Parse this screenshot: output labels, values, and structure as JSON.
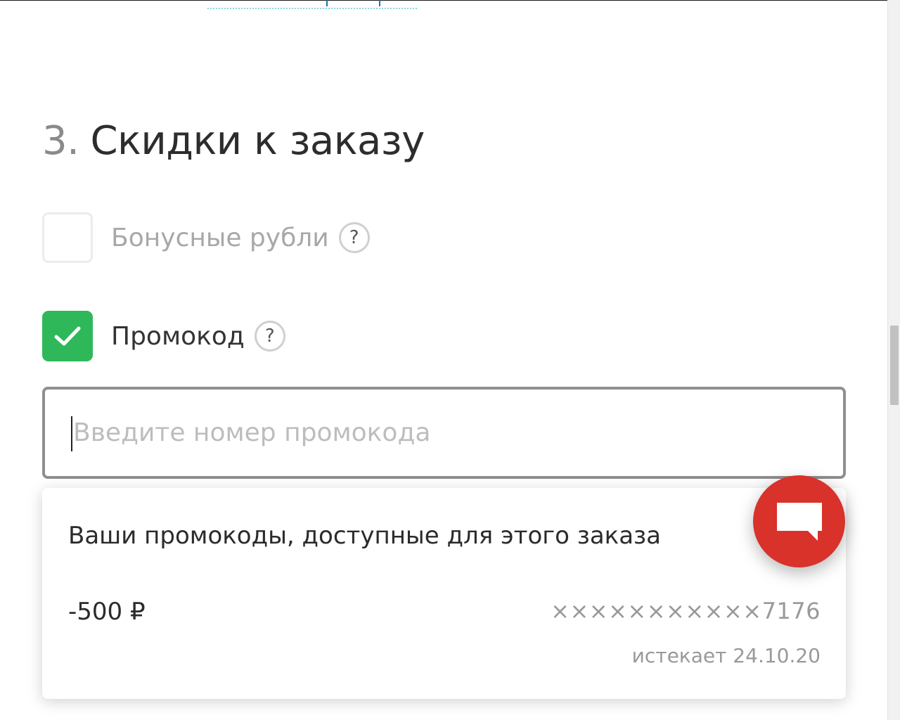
{
  "section": {
    "number": "3.",
    "title": "Скидки к заказу"
  },
  "bonus": {
    "label": "Бонусные рубли",
    "checked": false,
    "help": "?"
  },
  "promo": {
    "label": "Промокод",
    "checked": true,
    "help": "?",
    "input_value": "",
    "input_placeholder": "Введите номер промокода"
  },
  "dropdown": {
    "title": "Ваши промокоды, доступные для этого заказа",
    "items": [
      {
        "amount": "-500 ₽",
        "code": "×××××××××××7176",
        "expiry": "истекает 24.10.20"
      }
    ]
  },
  "colors": {
    "check_green": "#2fb85a",
    "chat_red": "#d8322b"
  },
  "icons": {
    "checkmark": "checkmark-icon",
    "help": "question-icon",
    "chat": "chat-bubble-icon"
  }
}
